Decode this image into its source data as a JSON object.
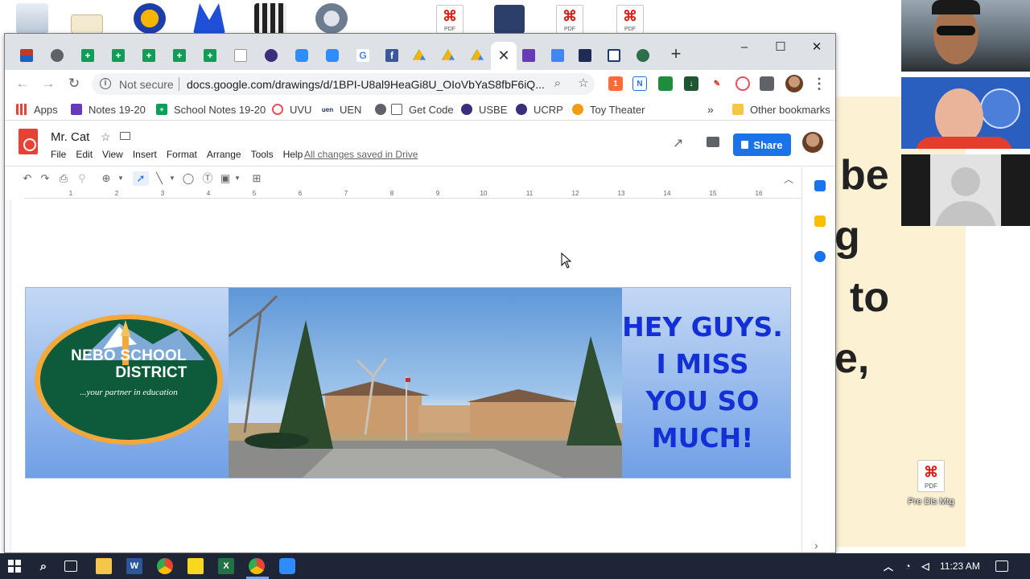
{
  "browser": {
    "url_security": "Not secure",
    "url": "docs.google.com/drawings/d/1BPI-U8al9HeaGi8U_OIoVbYaS8fbF6iQ...",
    "bookmarks": [
      "Apps",
      "Notes 19-20",
      "School Notes 19-20",
      "UVU",
      "UEN",
      "Get Code",
      "USBE",
      "UCRP",
      "Toy Theater"
    ],
    "bookmarks_overflow": "»",
    "other_bookmarks": "Other bookmarks"
  },
  "doc": {
    "title": "Mr. Cat",
    "menus": [
      "File",
      "Edit",
      "View",
      "Insert",
      "Format",
      "Arrange",
      "Tools",
      "Help"
    ],
    "save_status": "All changes saved in Drive",
    "share_label": "Share"
  },
  "ruler": [
    "1",
    "2",
    "3",
    "4",
    "5",
    "6",
    "7",
    "8",
    "9",
    "10",
    "11",
    "12",
    "13",
    "14",
    "15",
    "16"
  ],
  "banner": {
    "logo_name_line1": "NEBO SCHOOL",
    "logo_name_line2": "DISTRICT",
    "logo_tagline": "...your partner in education",
    "message": "HEY GUYS. I MISS YOU SO MUCH!"
  },
  "desktop": {
    "pdf_label": "PDF",
    "pdf_file_label": "Pre Dis Mtg",
    "slide_words": [
      "be",
      "g",
      "to",
      "e,"
    ]
  },
  "taskbar": {
    "clock": "11:23 AM"
  },
  "colors": {
    "share_blue": "#1a73e8",
    "banner_text": "#1330d6",
    "logo_green": "#0d5b3b",
    "logo_orange": "#f2a93b"
  }
}
